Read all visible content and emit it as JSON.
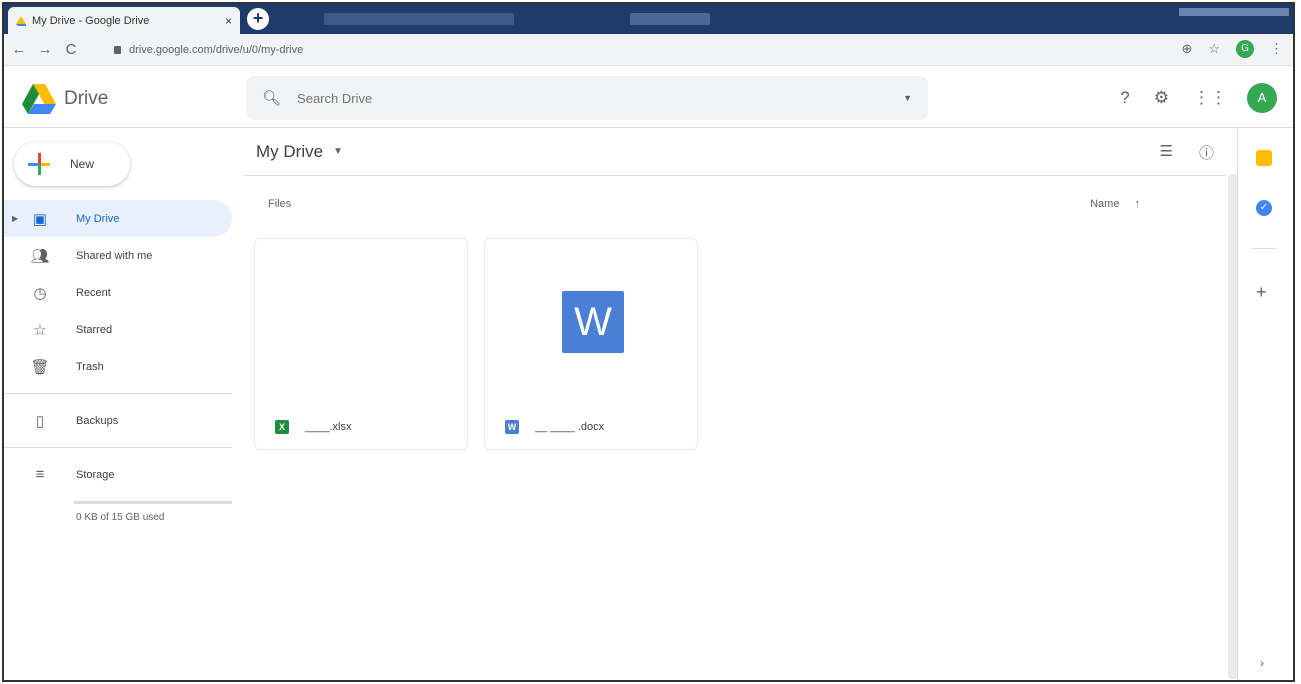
{
  "browser": {
    "tab_title": "My Drive - Google Drive",
    "tab_close": "×",
    "new_tab": "+",
    "nav_back": "←",
    "nav_forward": "→",
    "nav_reload": "C",
    "url": "drive.google.com/drive/u/0/my-drive",
    "profile_initial": "G"
  },
  "app": {
    "name": "Drive",
    "search_placeholder": "Search Drive",
    "avatar_initial": "A"
  },
  "sidebar": {
    "new_label": "New",
    "items": [
      {
        "label": "My Drive",
        "icon": "my-drive-icon",
        "active": true
      },
      {
        "label": "Shared with me",
        "icon": "shared-icon"
      },
      {
        "label": "Recent",
        "icon": "clock-icon"
      },
      {
        "label": "Starred",
        "icon": "star-icon"
      },
      {
        "label": "Trash",
        "icon": "trash-icon"
      }
    ],
    "backups_label": "Backups",
    "storage_label": "Storage",
    "storage_used": "0 KB of 15 GB used"
  },
  "main": {
    "title": "My Drive",
    "section_label": "Files",
    "sort_label": "Name",
    "sort_arrow": "↑",
    "files": [
      {
        "name": "____.xlsx",
        "type_letter": "X",
        "type_color": "#1e8e3e"
      },
      {
        "name": "__ ____ .docx",
        "type_letter": "W",
        "type_color": "#4a7fd6"
      }
    ]
  }
}
